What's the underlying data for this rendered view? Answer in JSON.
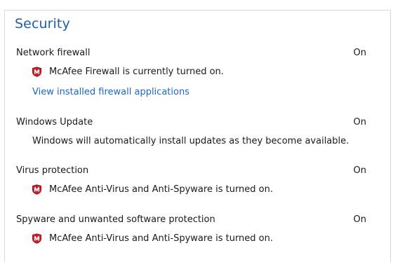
{
  "section": {
    "title": "Security"
  },
  "items": [
    {
      "title": "Network firewall",
      "status": "On",
      "detail": "McAfee Firewall is currently turned on.",
      "icon": "mcafee-shield-icon",
      "link": "View installed firewall applications"
    },
    {
      "title": "Windows Update",
      "status": "On",
      "detail": "Windows will automatically install updates as they become available."
    },
    {
      "title": "Virus protection",
      "status": "On",
      "detail": "McAfee Anti-Virus and Anti-Spyware is turned on.",
      "icon": "mcafee-shield-icon"
    },
    {
      "title": "Spyware and unwanted software protection",
      "status": "On",
      "detail": "McAfee Anti-Virus and Anti-Spyware is turned on.",
      "icon": "mcafee-shield-icon"
    }
  ],
  "colors": {
    "heading": "#1e5fa8",
    "link": "#1a68c7",
    "shield_red": "#c8202a"
  }
}
